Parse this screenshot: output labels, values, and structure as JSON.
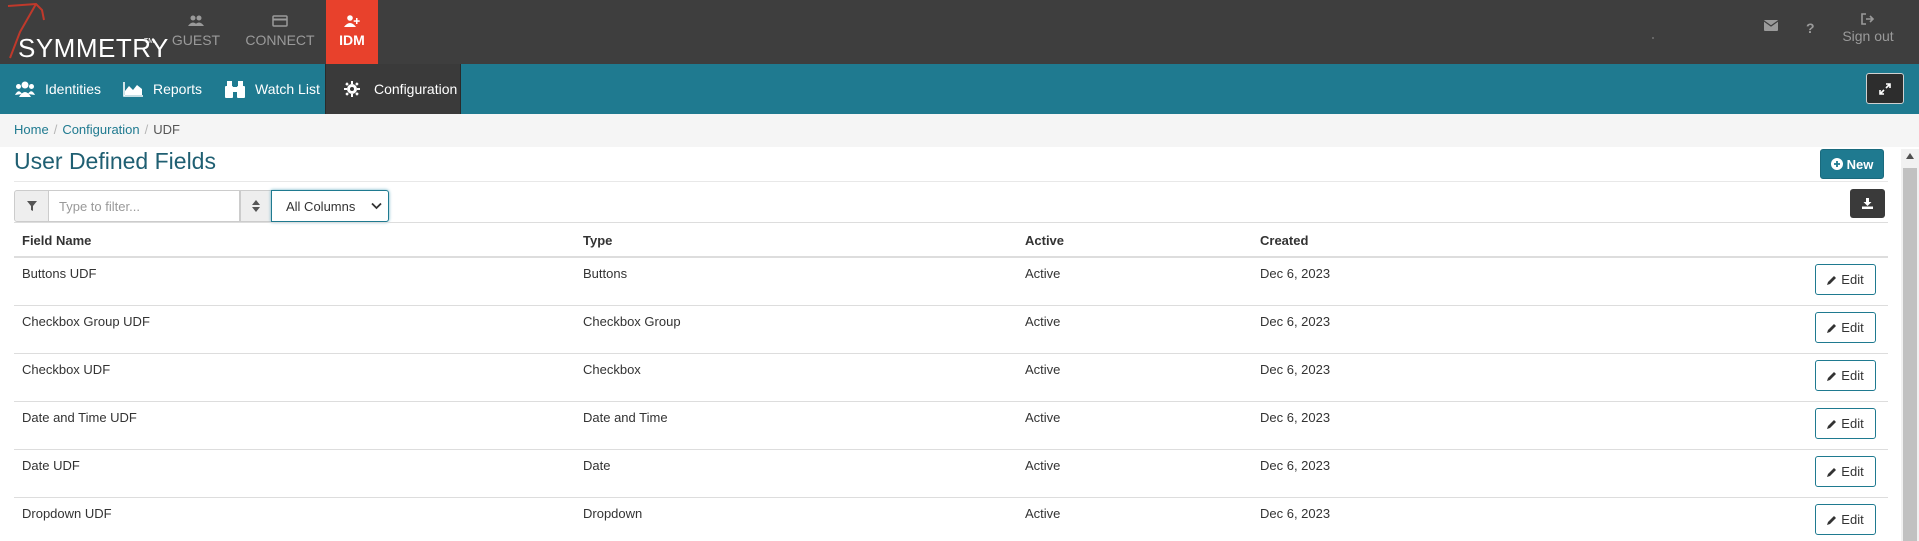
{
  "brand": {
    "name": "SYMMETRY",
    "tm": "TM"
  },
  "app_tabs": [
    {
      "label": "GUEST",
      "icon": "users-icon"
    },
    {
      "label": "CONNECT",
      "icon": "card-icon"
    },
    {
      "label": "IDM",
      "icon": "user-plus-icon",
      "active": true
    }
  ],
  "top_right": {
    "mail_icon": "envelope-icon",
    "help_icon": "question-icon",
    "signout_label": "Sign out"
  },
  "nav": {
    "items": [
      {
        "label": "Identities",
        "icon": "users-icon"
      },
      {
        "label": "Reports",
        "icon": "area-chart-icon"
      },
      {
        "label": "Watch List",
        "icon": "binoculars-icon"
      },
      {
        "label": "Configuration",
        "icon": "gear-icon",
        "active": true
      }
    ]
  },
  "breadcrumb": {
    "home": "Home",
    "section": "Configuration",
    "current": "UDF",
    "separator": "/"
  },
  "page": {
    "title": "User Defined Fields",
    "new_label": "New"
  },
  "filter": {
    "placeholder": "Type to filter...",
    "column_select": "All Columns"
  },
  "table": {
    "columns": [
      "Field Name",
      "Type",
      "Active",
      "Created"
    ],
    "rows": [
      {
        "name": "Buttons UDF",
        "type": "Buttons",
        "active": "Active",
        "created": "Dec 6, 2023"
      },
      {
        "name": "Checkbox Group UDF",
        "type": "Checkbox Group",
        "active": "Active",
        "created": "Dec 6, 2023"
      },
      {
        "name": "Checkbox UDF",
        "type": "Checkbox",
        "active": "Active",
        "created": "Dec 6, 2023"
      },
      {
        "name": "Date and Time UDF",
        "type": "Date and Time",
        "active": "Active",
        "created": "Dec 6, 2023"
      },
      {
        "name": "Date UDF",
        "type": "Date",
        "active": "Active",
        "created": "Dec 6, 2023"
      },
      {
        "name": "Dropdown UDF",
        "type": "Dropdown",
        "active": "Active",
        "created": "Dec 6, 2023"
      }
    ],
    "edit_label": "Edit"
  },
  "colors": {
    "topbar": "#3e3e3e",
    "accent_red": "#e8412c",
    "teal": "#1f7a90",
    "dark": "#3a3a3a"
  }
}
